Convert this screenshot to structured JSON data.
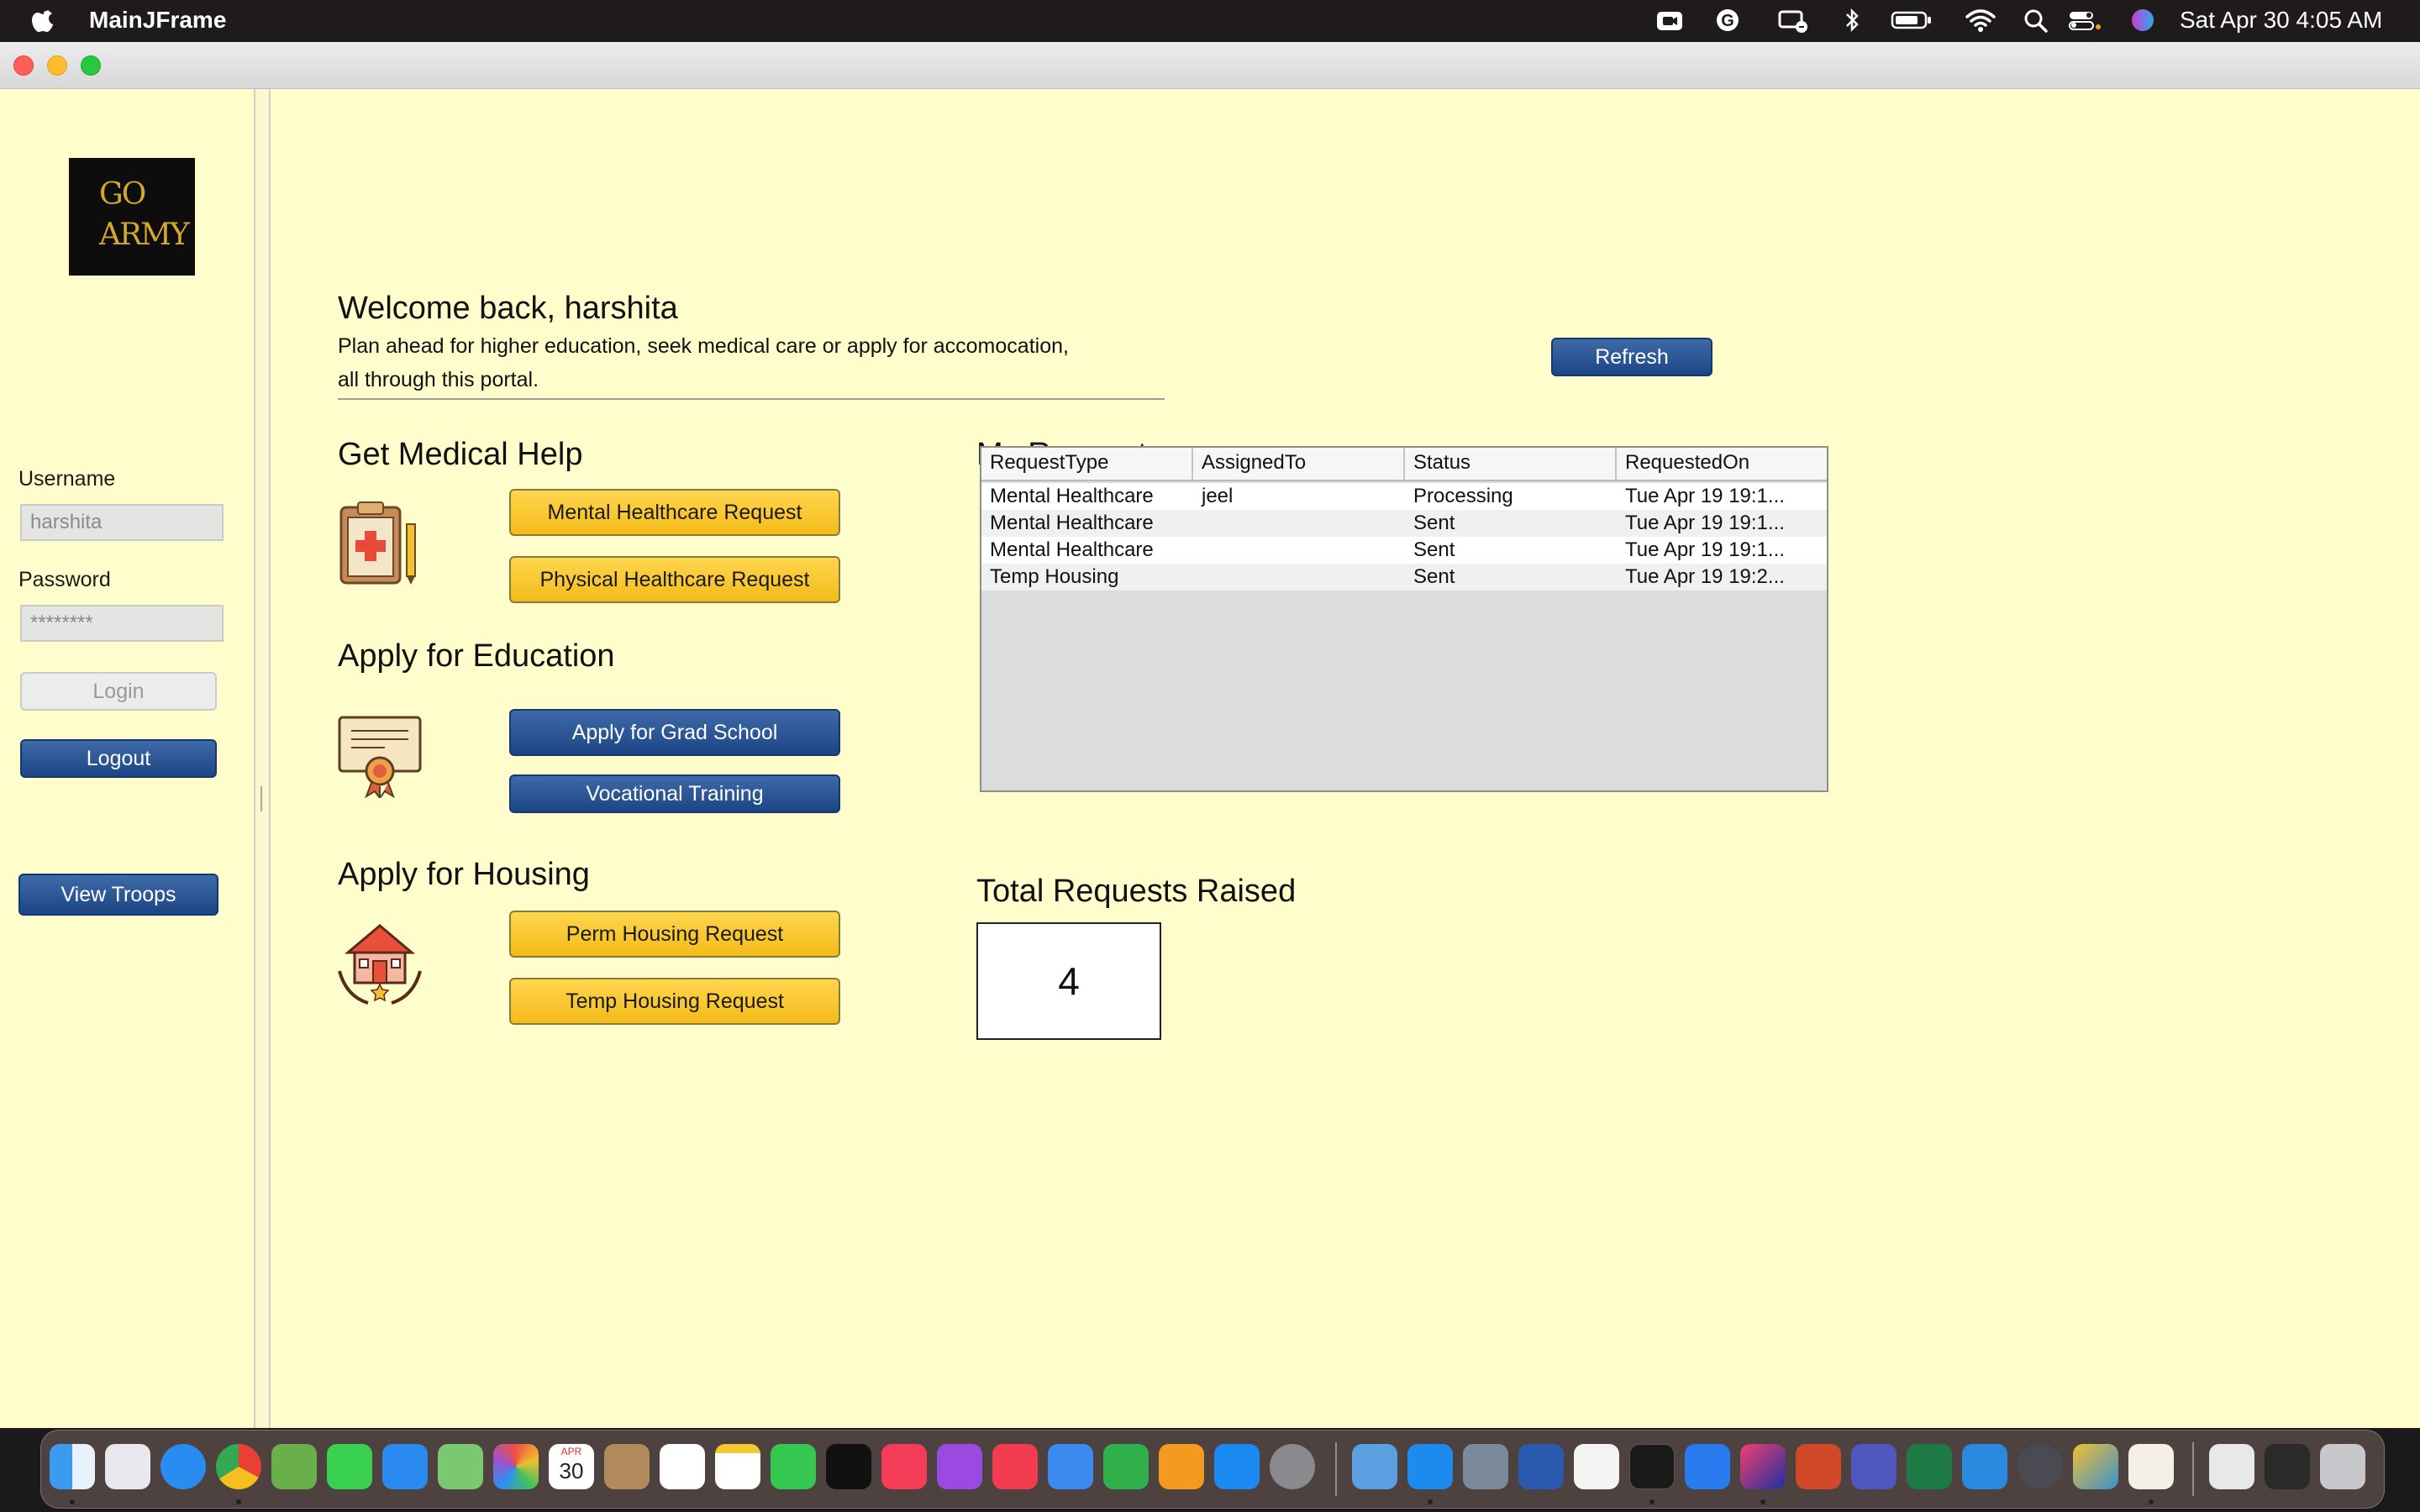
{
  "menubar": {
    "app_name": "MainJFrame",
    "clock": "Sat Apr 30  4:05 AM",
    "status_icons": [
      "facetime-camera-icon",
      "grammarly-icon",
      "display-icon",
      "bluetooth-icon",
      "battery-icon",
      "wifi-icon",
      "spotlight-search-icon",
      "control-center-icon",
      "siri-icon"
    ]
  },
  "sidebar": {
    "logo_line1": "GO",
    "logo_line2": "ARMY",
    "username_label": "Username",
    "username_value": "harshita",
    "password_label": "Password",
    "password_value": "********",
    "login_label": "Login",
    "logout_label": "Logout",
    "view_troops_label": "View Troops"
  },
  "main": {
    "welcome": "Welcome back, harshita",
    "subtitle_line1": "Plan ahead for higher education, seek medical care or apply for accomocation,",
    "subtitle_line2": "all through this portal.",
    "refresh_label": "Refresh",
    "medical": {
      "title": "Get Medical Help",
      "mental_label": "Mental Healthcare Request",
      "physical_label": "Physical Healthcare Request"
    },
    "education": {
      "title": "Apply for Education",
      "grad_label": "Apply for Grad School",
      "vocational_label": "Vocational Training"
    },
    "housing": {
      "title": "Apply for Housing",
      "perm_label": "Perm Housing Request",
      "temp_label": "Temp Housing Request"
    },
    "requests": {
      "title": "My Requests",
      "columns": [
        "RequestType",
        "AssignedTo",
        "Status",
        "RequestedOn"
      ],
      "rows": [
        [
          "Mental Healthcare",
          "jeel",
          "Processing",
          "Tue Apr 19 19:1..."
        ],
        [
          "Mental Healthcare",
          "",
          "Sent",
          "Tue Apr 19 19:1..."
        ],
        [
          "Mental Healthcare",
          "",
          "Sent",
          "Tue Apr 19 19:1..."
        ],
        [
          "Temp Housing",
          "",
          "Sent",
          "Tue Apr 19 19:2..."
        ]
      ]
    },
    "total": {
      "title": "Total Requests Raised",
      "value": "4"
    }
  },
  "dock": {
    "apps": [
      "finder-icon",
      "launchpad-icon",
      "safari-icon",
      "chrome-icon",
      "spring-tool-icon",
      "messages-icon",
      "mail-icon",
      "maps-icon",
      "photos-icon",
      "calendar-icon",
      "contacts-icon",
      "reminders-icon",
      "notes-icon",
      "facetime-icon",
      "apple-tv-icon",
      "music-icon",
      "podcasts-icon",
      "news-icon",
      "keynote-icon",
      "numbers-icon",
      "pages-icon",
      "app-store-icon",
      "system-preferences-icon",
      "preview-icon",
      "docker-icon",
      "image-capture-icon",
      "word-icon",
      "textedit-icon",
      "terminal-icon",
      "zoom-icon",
      "intellij-icon",
      "powerpoint-icon",
      "teams-icon",
      "excel-icon",
      "vscode-icon",
      "quicktime-icon",
      "netbeans-icon",
      "java-icon",
      "downloads-folder-icon",
      "desktop-folder-icon",
      "trash-icon"
    ],
    "calendar_month": "APR",
    "calendar_day": "30"
  }
}
